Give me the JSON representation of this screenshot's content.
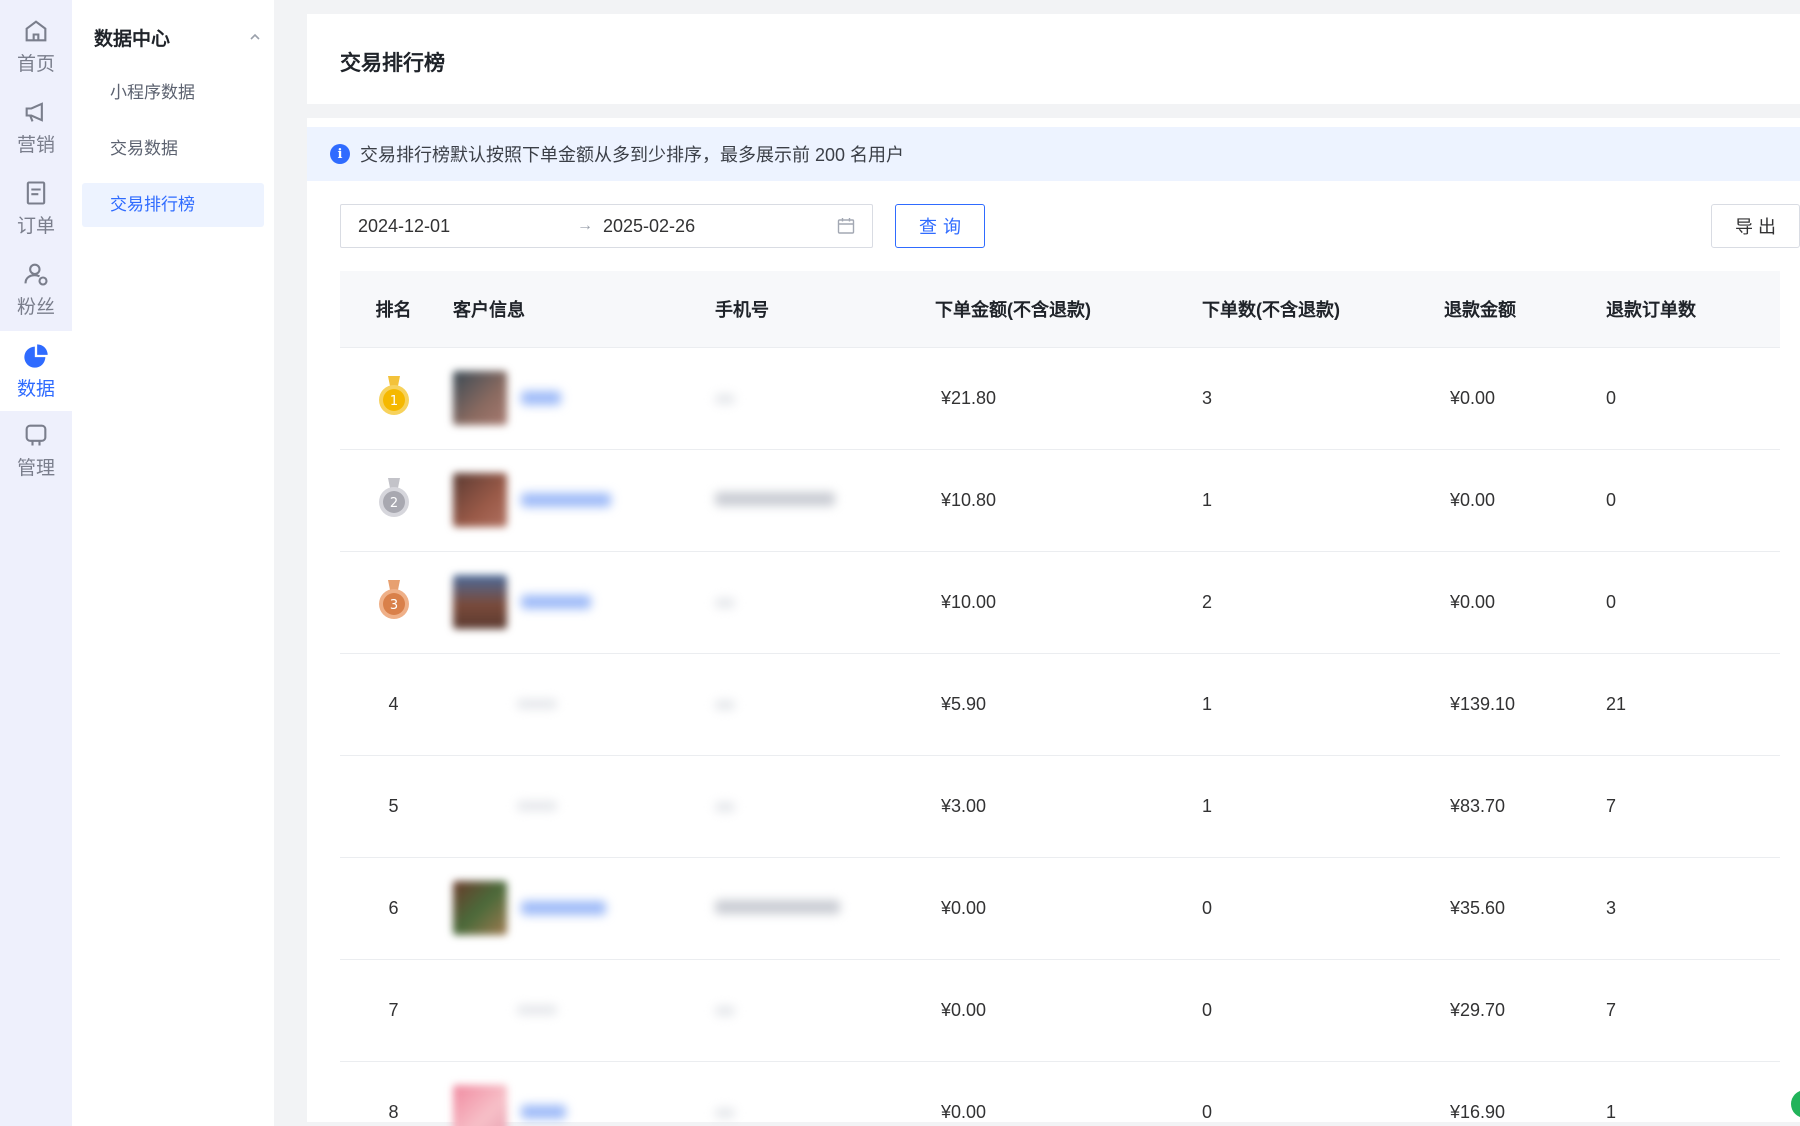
{
  "rail": {
    "items": [
      {
        "label": "首页",
        "icon": "home-icon"
      },
      {
        "label": "营销",
        "icon": "megaphone-icon"
      },
      {
        "label": "订单",
        "icon": "order-icon"
      },
      {
        "label": "粉丝",
        "icon": "fans-icon"
      },
      {
        "label": "数据",
        "icon": "pie-chart-icon",
        "active": true
      },
      {
        "label": "管理",
        "icon": "shop-icon"
      }
    ]
  },
  "submenu": {
    "title": "数据中心",
    "items": [
      "小程序数据",
      "交易数据",
      "交易排行榜"
    ],
    "active": "交易排行榜"
  },
  "page": {
    "title": "交易排行榜",
    "notice": "交易排行榜默认按照下单金额从多到少排序，最多展示前 200 名用户"
  },
  "filter": {
    "date_from": "2024-12-01",
    "arrow": "→",
    "date_to": "2025-02-26",
    "query_label": "查询",
    "export_label": "导出"
  },
  "table": {
    "headers": [
      "排名",
      "客户信息",
      "手机号",
      "下单金额(不含退款)",
      "下单数(不含退款)",
      "退款金额",
      "退款订单数"
    ],
    "rows": [
      {
        "rank": "1",
        "amount": "¥21.80",
        "orders": "3",
        "refund": "¥0.00",
        "refund_orders": "0"
      },
      {
        "rank": "2",
        "amount": "¥10.80",
        "orders": "1",
        "refund": "¥0.00",
        "refund_orders": "0"
      },
      {
        "rank": "3",
        "amount": "¥10.00",
        "orders": "2",
        "refund": "¥0.00",
        "refund_orders": "0"
      },
      {
        "rank": "4",
        "amount": "¥5.90",
        "orders": "1",
        "refund": "¥139.10",
        "refund_orders": "21"
      },
      {
        "rank": "5",
        "amount": "¥3.00",
        "orders": "1",
        "refund": "¥83.70",
        "refund_orders": "7"
      },
      {
        "rank": "6",
        "amount": "¥0.00",
        "orders": "0",
        "refund": "¥35.60",
        "refund_orders": "3"
      },
      {
        "rank": "7",
        "amount": "¥0.00",
        "orders": "0",
        "refund": "¥29.70",
        "refund_orders": "7"
      },
      {
        "rank": "8",
        "amount": "¥0.00",
        "orders": "0",
        "refund": "¥16.90",
        "refund_orders": "1"
      }
    ]
  },
  "colors": {
    "accent": "#2f6bff",
    "rail_bg": "#eef0fc",
    "notice_bg": "#edf3ff",
    "gold": "#f5b800",
    "silver": "#a8a8b0",
    "bronze": "#d9804a"
  }
}
